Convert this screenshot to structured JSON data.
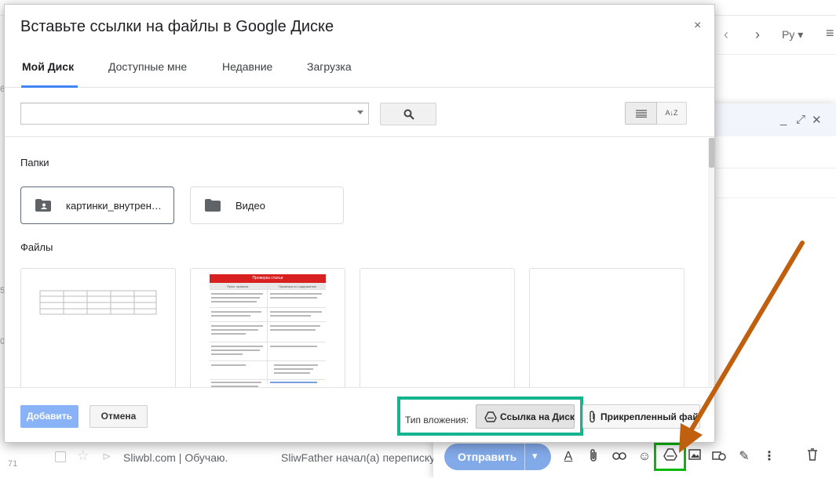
{
  "dialog": {
    "title": "Вставьте ссылки на файлы в Google Диске",
    "close_label": "×",
    "tabs": [
      {
        "label": "Мой Диск",
        "active": true
      },
      {
        "label": "Доступные мне",
        "active": false
      },
      {
        "label": "Недавние",
        "active": false
      },
      {
        "label": "Загрузка",
        "active": false
      }
    ],
    "search": {
      "value": "",
      "placeholder": ""
    },
    "sort_label": "A↓Z",
    "folders_label": "Папки",
    "folders": [
      {
        "name": "картинки_внутренние",
        "icon": "shared-folder-icon",
        "selected": true
      },
      {
        "name": "Видео",
        "icon": "folder-icon",
        "selected": false
      }
    ],
    "files_label": "Файлы",
    "doc_preview": {
      "title": "Проверка статьи",
      "col1": "Пункт правила",
      "col2": "Проверка по содержанию"
    },
    "footer": {
      "add_label": "Добавить",
      "cancel_label": "Отмена",
      "attach_type_label": "Тип вложения:",
      "drive_link_label": "Ссылка на Диск",
      "attached_file_label": "Прикрепленный файл"
    }
  },
  "gmail": {
    "lang_label": "Ру",
    "row": {
      "number": "71",
      "sender": "Sliwbl.com | Обучаю.",
      "subject": "SliwFather начал(а) переписку"
    },
    "left_numbers": [
      "6",
      "5",
      "0"
    ],
    "compose": {
      "send_label": "Отправить"
    }
  },
  "colors": {
    "highlight_green": "#08b808",
    "attach_box_teal": "#15b38e",
    "arrow_orange": "#c0600f",
    "accent_blue": "#4285f4"
  }
}
